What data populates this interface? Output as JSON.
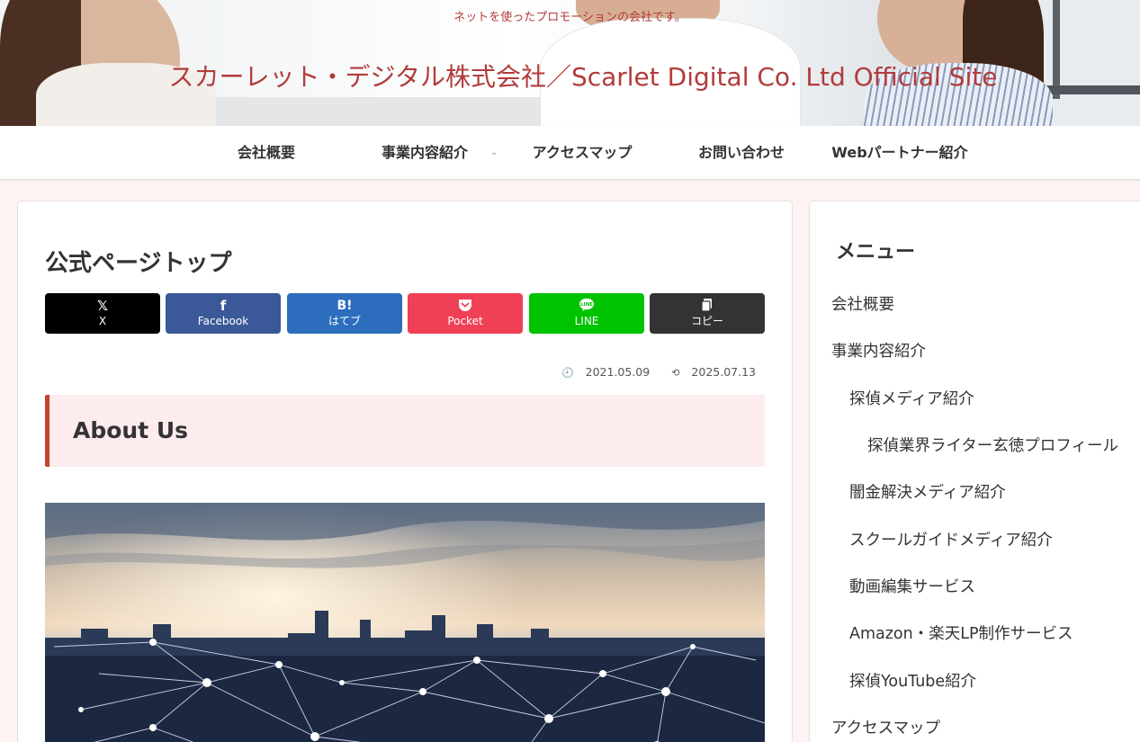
{
  "header": {
    "tagline": "ネットを使ったプロモーションの会社です。",
    "site_title": "スカーレット・デジタル株式会社／Scarlet Digital Co. Ltd Official Site"
  },
  "nav": {
    "items": [
      {
        "label": "会社概要",
        "has_submenu": false
      },
      {
        "label": "事業内容紹介",
        "has_submenu": true
      },
      {
        "label": "アクセスマップ",
        "has_submenu": false
      },
      {
        "label": "お問い合わせ",
        "has_submenu": false
      },
      {
        "label": "Webパートナー紹介",
        "has_submenu": false
      }
    ]
  },
  "main": {
    "page_title": "公式ページトップ",
    "share_buttons": [
      {
        "label": "X",
        "icon": "x-logo-icon",
        "color": "#000000"
      },
      {
        "label": "Facebook",
        "icon": "facebook-icon",
        "color": "#3b5998"
      },
      {
        "label": "はてブ",
        "icon": "hatena-bookmark-icon",
        "color": "#2c6ebd"
      },
      {
        "label": "Pocket",
        "icon": "pocket-icon",
        "color": "#ef4056"
      },
      {
        "label": "LINE",
        "icon": "line-icon",
        "color": "#00c300"
      },
      {
        "label": "コピー",
        "icon": "copy-icon",
        "color": "#333333"
      }
    ],
    "published_date": "2021.05.09",
    "updated_date": "2025.07.13",
    "section_heading": "About Us",
    "accent_color": "#c8402f"
  },
  "sidebar": {
    "title": "メニュー",
    "items": [
      {
        "label": "会社概要",
        "level": 0
      },
      {
        "label": "事業内容紹介",
        "level": 0
      },
      {
        "label": "探偵メディア紹介",
        "level": 1
      },
      {
        "label": "探偵業界ライター玄徳プロフィール",
        "level": 2
      },
      {
        "label": "闇金解決メディア紹介",
        "level": 1
      },
      {
        "label": "スクールガイドメディア紹介",
        "level": 1
      },
      {
        "label": "動画編集サービス",
        "level": 1
      },
      {
        "label": "Amazon・楽天LP制作サービス",
        "level": 1
      },
      {
        "label": "探偵YouTube紹介",
        "level": 1
      },
      {
        "label": "アクセスマップ",
        "level": 0
      }
    ]
  },
  "colors": {
    "brand_red": "#b23b3b",
    "page_background": "#fdf3f2"
  }
}
